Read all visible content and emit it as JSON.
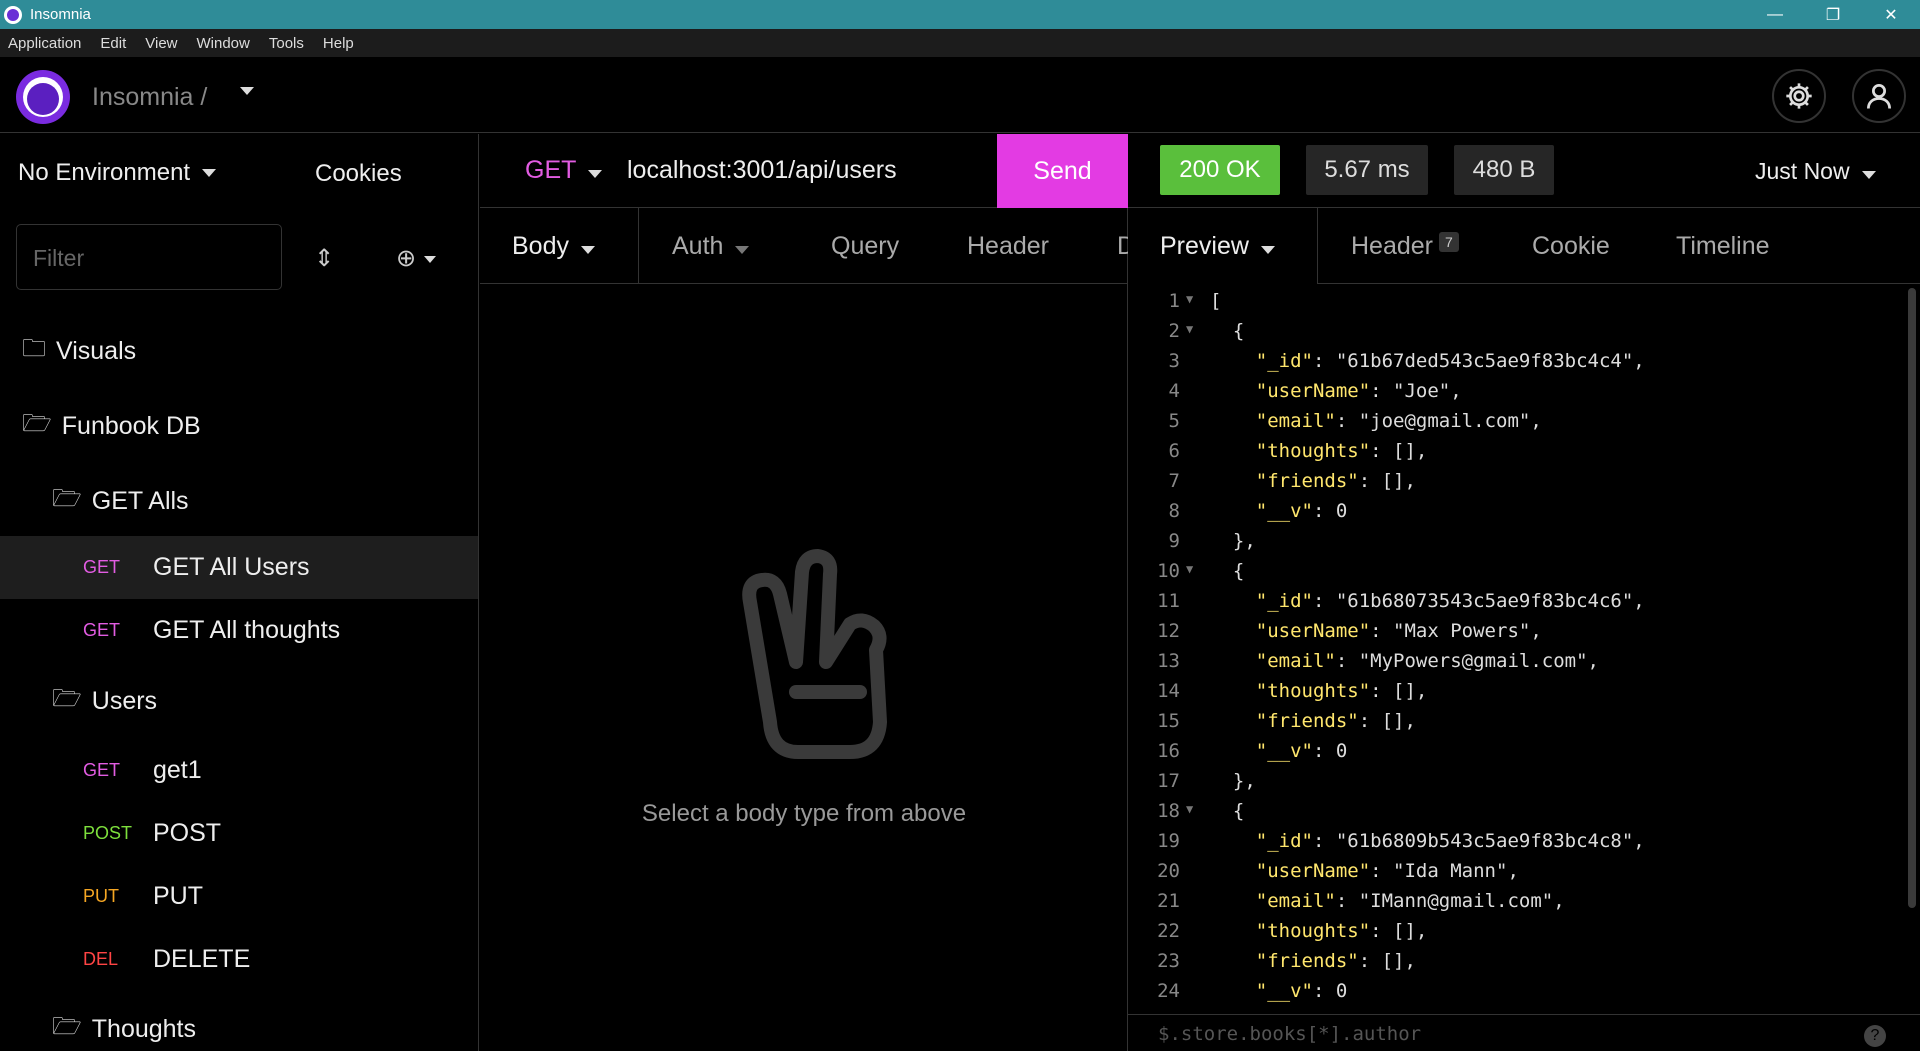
{
  "titlebar": {
    "title": "Insomnia",
    "minimize": "—",
    "maximize": "❐",
    "close": "✕"
  },
  "menu": [
    "Application",
    "Edit",
    "View",
    "Window",
    "Tools",
    "Help"
  ],
  "header": {
    "brand": "Insomnia /"
  },
  "sidebar": {
    "environment": "No Environment",
    "cookies": "Cookies",
    "filter_placeholder": "Filter",
    "folders": {
      "visuals": "Visuals",
      "funbook": "Funbook DB",
      "get_alls": "GET Alls",
      "users": "Users",
      "thoughts": "Thoughts"
    },
    "requests": [
      {
        "method": "GET",
        "label": "GET All Users"
      },
      {
        "method": "GET",
        "label": "GET All thoughts"
      },
      {
        "method": "GET",
        "label": "get1"
      },
      {
        "method": "POST",
        "label": "POST"
      },
      {
        "method": "PUT",
        "label": "PUT"
      },
      {
        "method": "DEL",
        "label": "DELETE"
      }
    ]
  },
  "request": {
    "method": "GET",
    "url": "localhost:3001/api/users",
    "send": "Send",
    "tabs": [
      "Body",
      "Auth",
      "Query",
      "Header",
      "D"
    ],
    "empty_message": "Select a body type from above"
  },
  "response": {
    "status": "200 OK",
    "time": "5.67 ms",
    "size": "480 B",
    "when": "Just Now",
    "tabs": [
      "Preview",
      "Header",
      "Cookie",
      "Timeline"
    ],
    "header_count": "7",
    "filter_query": "$.store.books[*].author",
    "help": "?",
    "lines": [
      {
        "n": "1",
        "fold": "▼",
        "t": "["
      },
      {
        "n": "2",
        "fold": "▼",
        "t": "  {"
      },
      {
        "n": "3",
        "fold": "",
        "t": "    \"_id\": \"61b67ded543c5ae9f83bc4c4\","
      },
      {
        "n": "4",
        "fold": "",
        "t": "    \"userName\": \"Joe\","
      },
      {
        "n": "5",
        "fold": "",
        "t": "    \"email\": \"joe@gmail.com\","
      },
      {
        "n": "6",
        "fold": "",
        "t": "    \"thoughts\": [],"
      },
      {
        "n": "7",
        "fold": "",
        "t": "    \"friends\": [],"
      },
      {
        "n": "8",
        "fold": "",
        "t": "    \"__v\": 0"
      },
      {
        "n": "9",
        "fold": "",
        "t": "  },"
      },
      {
        "n": "10",
        "fold": "▼",
        "t": "  {"
      },
      {
        "n": "11",
        "fold": "",
        "t": "    \"_id\": \"61b68073543c5ae9f83bc4c6\","
      },
      {
        "n": "12",
        "fold": "",
        "t": "    \"userName\": \"Max Powers\","
      },
      {
        "n": "13",
        "fold": "",
        "t": "    \"email\": \"MyPowers@gmail.com\","
      },
      {
        "n": "14",
        "fold": "",
        "t": "    \"thoughts\": [],"
      },
      {
        "n": "15",
        "fold": "",
        "t": "    \"friends\": [],"
      },
      {
        "n": "16",
        "fold": "",
        "t": "    \"__v\": 0"
      },
      {
        "n": "17",
        "fold": "",
        "t": "  },"
      },
      {
        "n": "18",
        "fold": "▼",
        "t": "  {"
      },
      {
        "n": "19",
        "fold": "",
        "t": "    \"_id\": \"61b6809b543c5ae9f83bc4c8\","
      },
      {
        "n": "20",
        "fold": "",
        "t": "    \"userName\": \"Ida Mann\","
      },
      {
        "n": "21",
        "fold": "",
        "t": "    \"email\": \"IMann@gmail.com\","
      },
      {
        "n": "22",
        "fold": "",
        "t": "    \"thoughts\": [],"
      },
      {
        "n": "23",
        "fold": "",
        "t": "    \"friends\": [],"
      },
      {
        "n": "24",
        "fold": "",
        "t": "    \"__v\": 0"
      }
    ]
  },
  "colors": {
    "accent": "#e33be3",
    "ok": "#5abf3c",
    "titlebar": "#2f8c98",
    "brand": "#7a2be0"
  }
}
